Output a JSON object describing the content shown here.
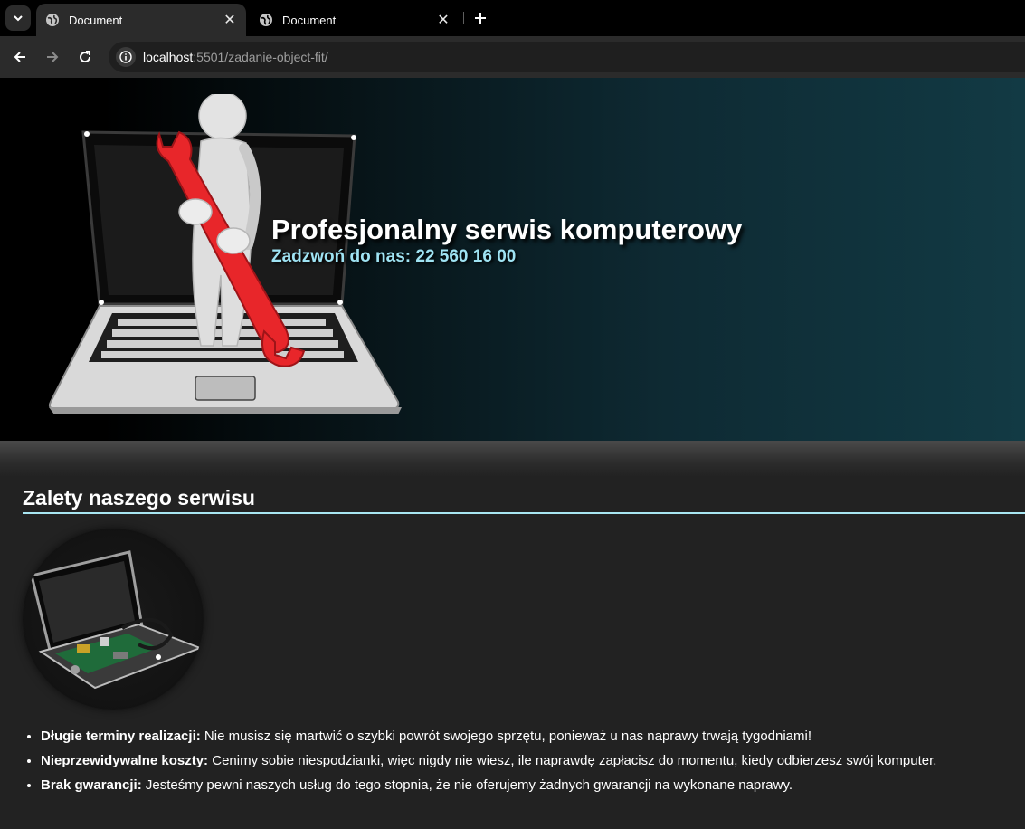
{
  "browser": {
    "tabs": [
      {
        "title": "Document",
        "active": true
      },
      {
        "title": "Document",
        "active": false
      }
    ],
    "url_host": "localhost",
    "url_path": ":5501/zadanie-object-fit/"
  },
  "hero": {
    "title": "Profesjonalny serwis komputerowy",
    "phone": "Zadzwoń do nas: 22 560 16 00"
  },
  "section": {
    "title": "Zalety naszego serwisu"
  },
  "features": [
    {
      "label": "Długie terminy realizacji:",
      "text": " Nie musisz się martwić o szybki powrót swojego sprzętu, ponieważ u nas naprawy trwają tygodniami!"
    },
    {
      "label": "Nieprzewidywalne koszty:",
      "text": " Cenimy sobie niespodzianki, więc nigdy nie wiesz, ile naprawdę zapłacisz do momentu, kiedy odbierzesz swój komputer."
    },
    {
      "label": "Brak gwarancji:",
      "text": " Jesteśmy pewni naszych usług do tego stopnia, że nie oferujemy żadnych gwarancji na wykonane naprawy."
    }
  ],
  "colors": {
    "accent": "#9fe3f3",
    "rule": "#a8e6f2",
    "page_bg": "#222222",
    "wrench": "#e8262a"
  }
}
